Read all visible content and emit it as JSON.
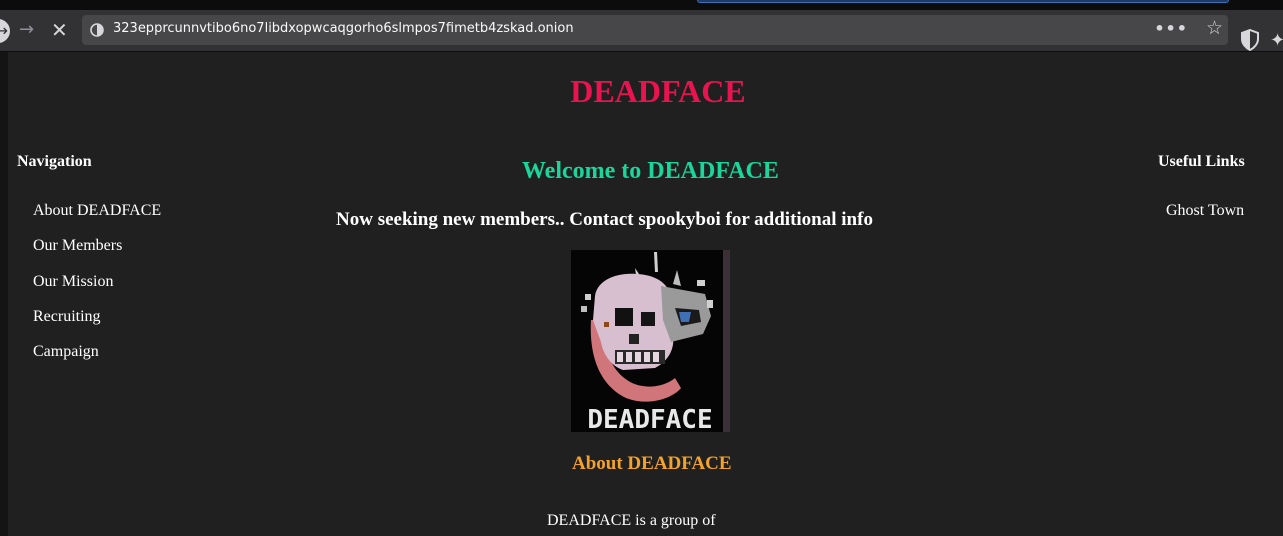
{
  "browser": {
    "url": "323epprcunnvtibo6no7libdxopwcaqgorho6slmpos7fimetb4zskad.onion",
    "overflow_icon": "•••",
    "icons": [
      "back-icon",
      "forward-icon",
      "stop-icon",
      "site-info-icon",
      "page-actions-icon",
      "bookmark-star-icon",
      "shield-icon",
      "extension-icon"
    ]
  },
  "site": {
    "title": "DEADFACE",
    "title_color": "#e8134f"
  },
  "nav": {
    "heading": "Navigation",
    "items": [
      {
        "label": "About DEADFACE"
      },
      {
        "label": "Our Members"
      },
      {
        "label": "Our Mission"
      },
      {
        "label": "Recruiting"
      },
      {
        "label": "Campaign"
      }
    ]
  },
  "links": {
    "heading": "Useful Links",
    "items": [
      {
        "label": "Ghost Town"
      }
    ]
  },
  "main": {
    "welcome": "Welcome to DEADFACE",
    "welcome_color": "#1ad69b",
    "seeking": "Now seeking new members.. Contact spookyboi for additional info",
    "logo_text": "DEADFACE",
    "about_heading": "About DEADFACE",
    "about_color": "#f3a22a",
    "about_text": "DEADFACE is a group of"
  }
}
